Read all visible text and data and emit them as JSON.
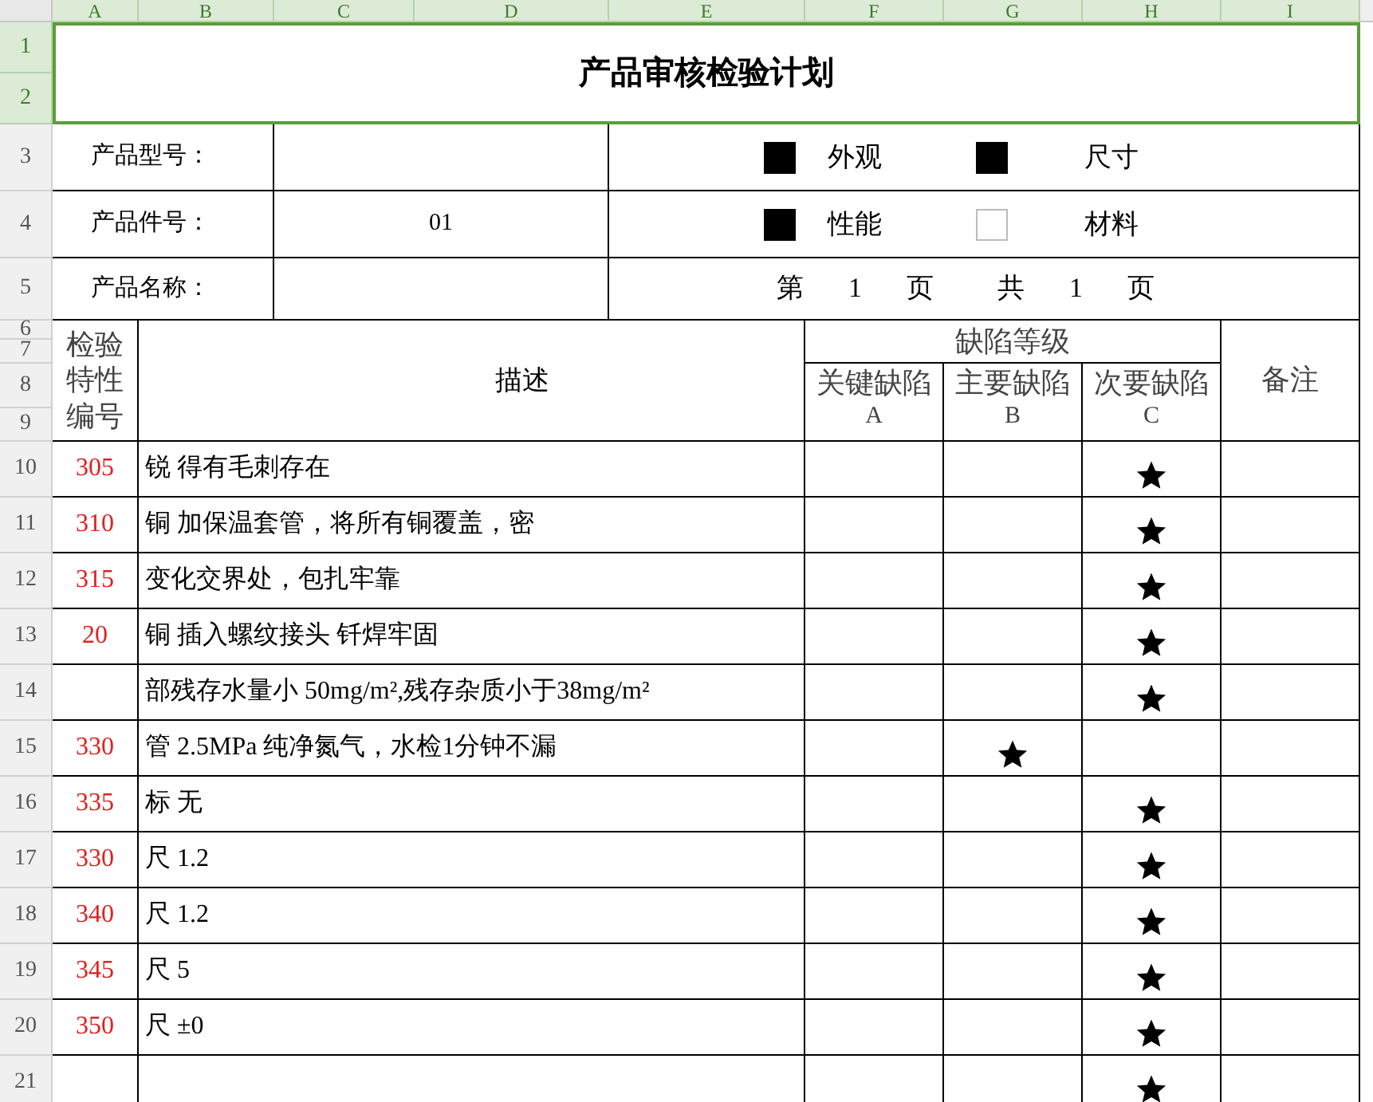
{
  "column_headers": [
    {
      "label": "A",
      "selected": true
    },
    {
      "label": "B",
      "selected": true
    },
    {
      "label": "C",
      "selected": true
    },
    {
      "label": "D",
      "selected": true
    },
    {
      "label": "E",
      "selected": true
    },
    {
      "label": "F",
      "selected": true
    },
    {
      "label": "G",
      "selected": true
    },
    {
      "label": "H",
      "selected": true
    },
    {
      "label": "I",
      "selected": true
    }
  ],
  "row_headers": [
    {
      "label": "1",
      "selected": true
    },
    {
      "label": "2",
      "selected": true
    },
    {
      "label": "3",
      "selected": false
    },
    {
      "label": "4",
      "selected": false
    },
    {
      "label": "5",
      "selected": false
    },
    {
      "label": "6",
      "selected": false
    },
    {
      "label": "7",
      "selected": false
    },
    {
      "label": "8",
      "selected": false
    },
    {
      "label": "9",
      "selected": false
    },
    {
      "label": "10",
      "selected": false
    },
    {
      "label": "11",
      "selected": false
    },
    {
      "label": "12",
      "selected": false
    },
    {
      "label": "13",
      "selected": false
    },
    {
      "label": "14",
      "selected": false
    },
    {
      "label": "15",
      "selected": false
    },
    {
      "label": "16",
      "selected": false
    },
    {
      "label": "17",
      "selected": false
    },
    {
      "label": "18",
      "selected": false
    },
    {
      "label": "19",
      "selected": false
    },
    {
      "label": "20",
      "selected": false
    },
    {
      "label": "21",
      "selected": false
    }
  ],
  "title": "产品审核检验计划",
  "info_rows": [
    {
      "label": "产品型号："
    },
    {
      "label": "产品件号：",
      "value": "01"
    },
    {
      "label": "产品名称："
    }
  ],
  "check_rows": [
    {
      "items": [
        {
          "label": "外观",
          "checked": true
        },
        {
          "label": "尺寸",
          "checked": true
        }
      ]
    },
    {
      "items": [
        {
          "label": "性能",
          "checked": true
        },
        {
          "label": "材料",
          "checked": false
        }
      ]
    }
  ],
  "page_info": [
    "第",
    "1",
    "页",
    "共",
    "1",
    "页"
  ],
  "table": {
    "code_header": "检验特性编号",
    "description_header": "描述",
    "grade_group": "缺陷等级",
    "grades": [
      {
        "name": "关键缺陷",
        "letter": "A"
      },
      {
        "name": "主要缺陷",
        "letter": "B"
      },
      {
        "name": "次要缺陷",
        "letter": "C"
      }
    ],
    "remarks_header": "备注",
    "rows": [
      {
        "code": "305",
        "description": "锐 得有毛刺存在",
        "grades": [
          {
            "starred": false
          },
          {
            "starred": false
          },
          {
            "starred": true
          }
        ]
      },
      {
        "code": "310",
        "description": "铜 加保温套管，将所有铜覆盖，密",
        "grades": [
          {
            "starred": false
          },
          {
            "starred": false
          },
          {
            "starred": true
          }
        ]
      },
      {
        "code": "315",
        "description": "变化交界处，包扎牢靠",
        "grades": [
          {
            "starred": false
          },
          {
            "starred": false
          },
          {
            "starred": true
          }
        ]
      },
      {
        "code": "20",
        "description": "铜 插入螺纹接头 钎焊牢固",
        "grades": [
          {
            "starred": false
          },
          {
            "starred": false
          },
          {
            "starred": true
          }
        ]
      },
      {
        "description": "部残存水量小 50mg/m²,残存杂质小于38mg/m²",
        "grades": [
          {
            "starred": false
          },
          {
            "starred": false
          },
          {
            "starred": true
          }
        ]
      },
      {
        "code": "330",
        "description": "管 2.5MPa 纯净氮气，水检1分钟不漏",
        "grades": [
          {
            "starred": false
          },
          {
            "starred": true
          },
          {
            "starred": false
          }
        ]
      },
      {
        "code": "335",
        "description": "标 无",
        "grades": [
          {
            "starred": false
          },
          {
            "starred": false
          },
          {
            "starred": true
          }
        ]
      },
      {
        "code": "330",
        "description": "尺 1.2",
        "grades": [
          {
            "starred": false
          },
          {
            "starred": false
          },
          {
            "starred": true
          }
        ]
      },
      {
        "code": "340",
        "description": "尺 1.2",
        "grades": [
          {
            "starred": false
          },
          {
            "starred": false
          },
          {
            "starred": true
          }
        ]
      },
      {
        "code": "345",
        "description": "尺 5",
        "grades": [
          {
            "starred": false
          },
          {
            "starred": false
          },
          {
            "starred": true
          }
        ]
      },
      {
        "code": "350",
        "description": "尺 ±0",
        "grades": [
          {
            "starred": false
          },
          {
            "starred": false
          },
          {
            "starred": true
          }
        ]
      },
      {
        "grades": [
          {
            "starred": false
          },
          {
            "starred": false
          },
          {
            "starred": true
          }
        ]
      }
    ]
  }
}
